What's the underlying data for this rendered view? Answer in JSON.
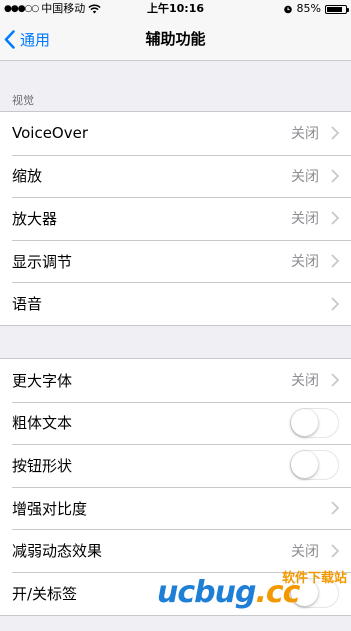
{
  "status_bar": {
    "carrier": "中国移动",
    "time": "上午10:16",
    "battery_percent": "85%",
    "battery_level": 0.85
  },
  "nav": {
    "back_label": "通用",
    "title": "辅助功能"
  },
  "sections": [
    {
      "header": "视觉",
      "rows": [
        {
          "label": "VoiceOver",
          "value": "关闭"
        },
        {
          "label": "缩放",
          "value": "关闭"
        },
        {
          "label": "放大器",
          "value": "关闭"
        },
        {
          "label": "显示调节",
          "value": "关闭"
        },
        {
          "label": "语音",
          "value": ""
        }
      ]
    },
    {
      "header": "",
      "rows": [
        {
          "label": "更大字体",
          "value": "关闭"
        },
        {
          "label": "粗体文本",
          "toggle": false
        },
        {
          "label": "按钮形状",
          "toggle": false
        },
        {
          "label": "增强对比度",
          "value": ""
        },
        {
          "label": "减弱动态效果",
          "value": "关闭"
        },
        {
          "label": "开/关标签",
          "toggle": false
        }
      ]
    }
  ],
  "watermark": {
    "logo": "ucbug",
    "suffix": ".cc",
    "subtitle": "软件下载站"
  },
  "colors": {
    "accent": "#007aff",
    "background": "#efeff4",
    "separator": "#c8c7cc",
    "secondary_text": "#8e8e93"
  },
  "icons": [
    "wifi-icon",
    "alarm-icon",
    "battery-icon",
    "back-chevron-icon",
    "chevron-right-icon"
  ]
}
